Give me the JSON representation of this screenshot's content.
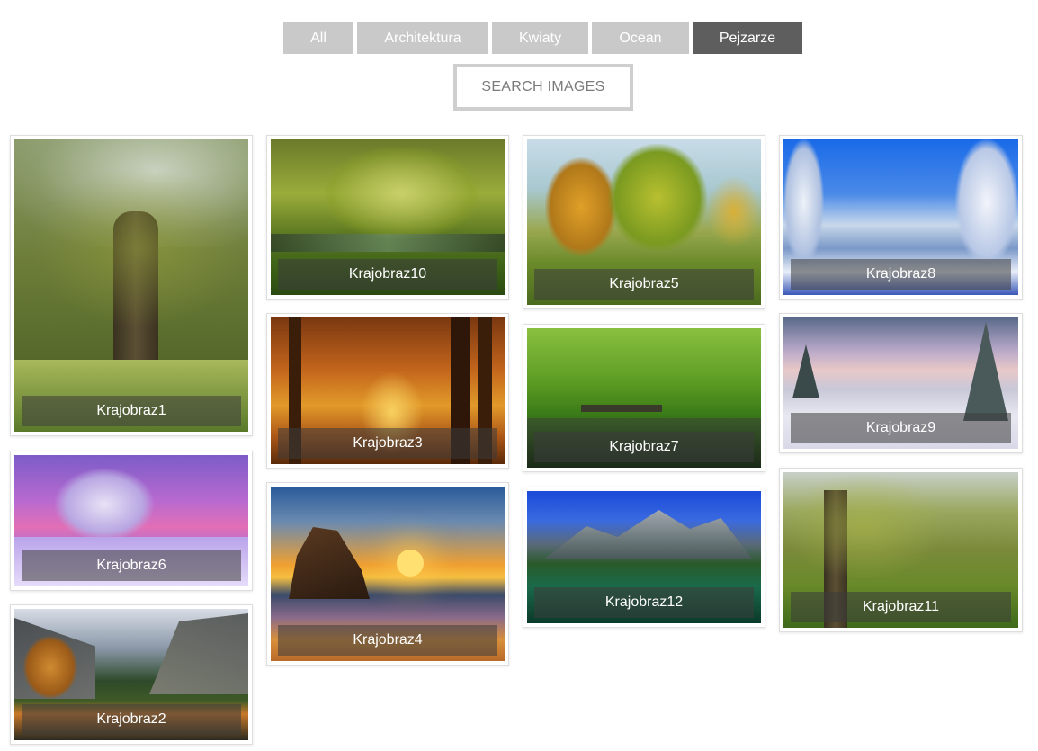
{
  "filters": [
    {
      "label": "All",
      "active": false
    },
    {
      "label": "Architektura",
      "active": false
    },
    {
      "label": "Kwiaty",
      "active": false
    },
    {
      "label": "Ocean",
      "active": false
    },
    {
      "label": "Pejzarze",
      "active": true
    }
  ],
  "search": {
    "placeholder": "SEARCH IMAGES"
  },
  "gallery": [
    {
      "caption": "Krajobraz1"
    },
    {
      "caption": "Krajobraz6"
    },
    {
      "caption": "Krajobraz2"
    },
    {
      "caption": "Krajobraz10"
    },
    {
      "caption": "Krajobraz3"
    },
    {
      "caption": "Krajobraz4"
    },
    {
      "caption": "Krajobraz5"
    },
    {
      "caption": "Krajobraz7"
    },
    {
      "caption": "Krajobraz12"
    },
    {
      "caption": "Krajobraz8"
    },
    {
      "caption": "Krajobraz9"
    },
    {
      "caption": "Krajobraz11"
    }
  ],
  "colors": {
    "filter_bg": "#c9c9c9",
    "filter_active_bg": "#5e5e5e",
    "search_border": "#cfcfcf"
  }
}
